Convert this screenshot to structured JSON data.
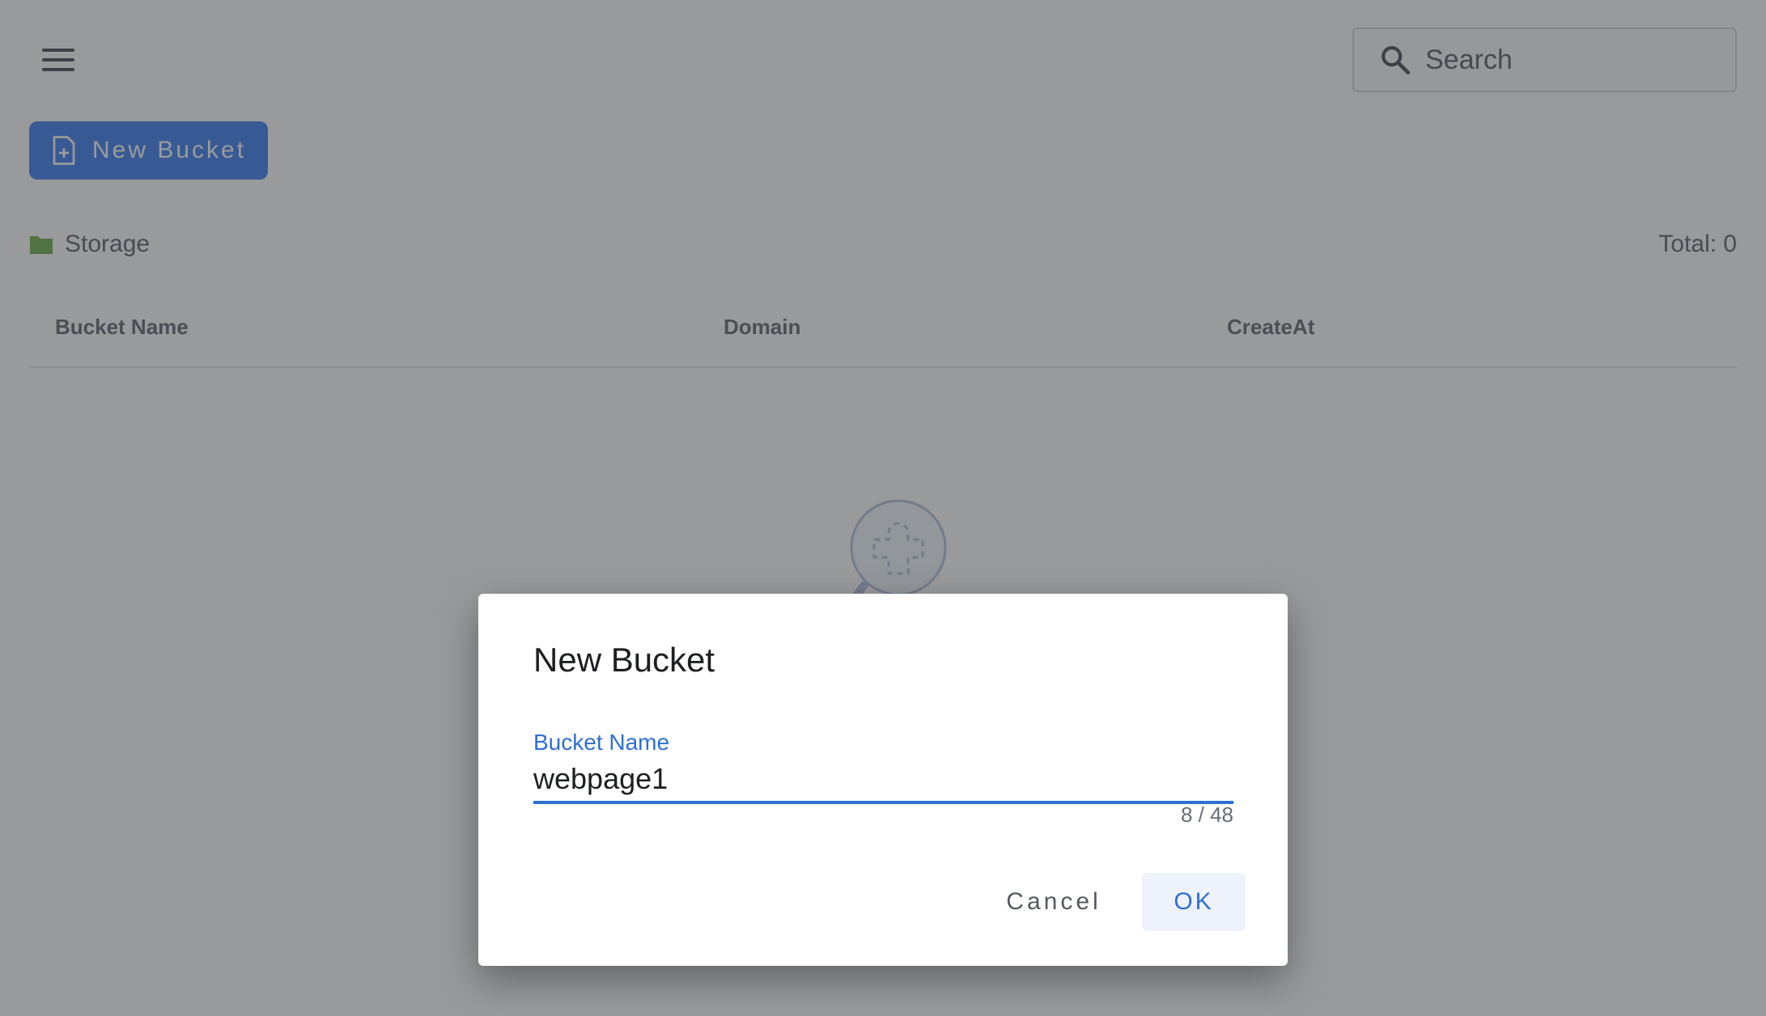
{
  "header": {
    "menu_icon": "menu-icon",
    "search": {
      "placeholder": "Search",
      "icon": "search-icon"
    }
  },
  "toolbar": {
    "new_bucket_label": "New Bucket",
    "new_bucket_icon": "file-add-icon"
  },
  "breadcrumb": {
    "label": "Storage",
    "icon": "folder-icon"
  },
  "total_label": "Total: 0",
  "table": {
    "columns": [
      "Bucket Name",
      "Domain",
      "CreateAt"
    ],
    "rows": []
  },
  "empty_state": {
    "icon": "empty-search-icon"
  },
  "dialog": {
    "title": "New Bucket",
    "field_label": "Bucket Name",
    "field_value": "webpage1",
    "counter": "8 / 48",
    "cancel_label": "Cancel",
    "ok_label": "OK"
  },
  "colors": {
    "primary": "#2f6fd1",
    "primary_button": "#4d8af0",
    "folder": "#7ab55c"
  }
}
